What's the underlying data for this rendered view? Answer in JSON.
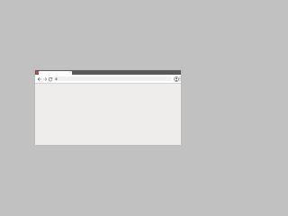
{
  "window": {
    "control_colors": [
      "#e0443e",
      "#dea123",
      "#1aab29"
    ]
  },
  "tab": {
    "title": "",
    "close_icon": "×"
  },
  "toolbar": {
    "back_icon": "back-arrow-icon",
    "forward_icon": "forward-arrow-icon",
    "reload_icon": "reload-icon",
    "menu_icon": "vertical-dots-icon"
  },
  "omnibox": {
    "url": "",
    "placeholder": ""
  },
  "colors": {
    "desktop": "#c2c1c1",
    "title_bar": "#5a5a5a",
    "toolbar": "#ffffff",
    "viewport": "#eeedec"
  }
}
